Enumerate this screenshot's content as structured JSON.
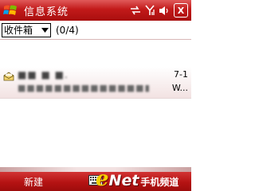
{
  "titlebar": {
    "title": "信息系统",
    "ok_label": "X"
  },
  "folderbar": {
    "folder_selected": "收件箱",
    "count": "(0/4)"
  },
  "message": {
    "sender": "■■ ■ ■.",
    "date": "7-1",
    "preview": "■■■■■■■■■■■■■■■■■■■■■■",
    "more": "W..."
  },
  "softbar": {
    "left_label": "新建"
  },
  "watermark": {
    "e": "e",
    "net": "Net",
    "cn": "手机频道"
  },
  "colors": {
    "titlebar": "#c21a1a",
    "softbar": "#b51313",
    "row": "#f2e2e2",
    "watermark_e": "#f4d200"
  },
  "icons": [
    "windows-start-icon",
    "sync-arrows-icon",
    "signal-icon",
    "speaker-icon",
    "read-envelope-icon",
    "keyboard-icon",
    "dropdown-arrow-icon"
  ]
}
